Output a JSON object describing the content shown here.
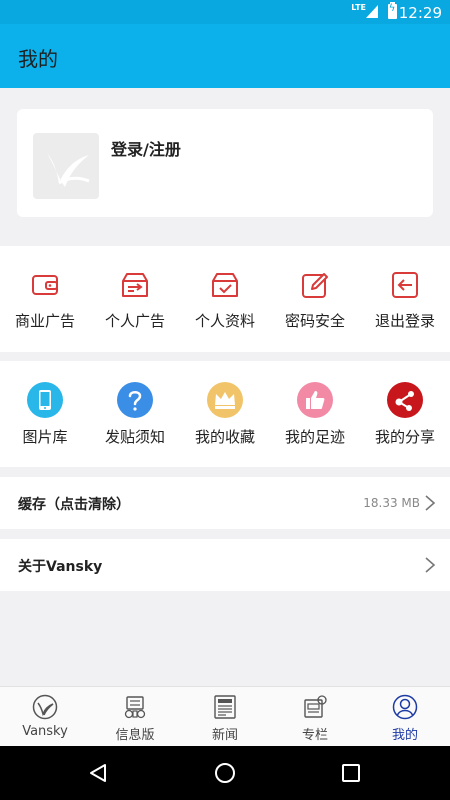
{
  "status_bar": {
    "network": "LTE",
    "time": "12:29"
  },
  "app_bar": {
    "title": "我的"
  },
  "profile": {
    "login_label": "登录/注册"
  },
  "actions": [
    {
      "label": "商业广告",
      "icon": "wallet-icon"
    },
    {
      "label": "个人广告",
      "icon": "box-arrow-icon"
    },
    {
      "label": "个人资料",
      "icon": "box-check-icon"
    },
    {
      "label": "密码安全",
      "icon": "edit-icon"
    },
    {
      "label": "退出登录",
      "icon": "logout-icon"
    }
  ],
  "features": [
    {
      "label": "图片库",
      "icon": "phone-icon",
      "color": "#29b6e8"
    },
    {
      "label": "发贴须知",
      "icon": "question-icon",
      "color": "#3a8ee6"
    },
    {
      "label": "我的收藏",
      "icon": "crown-icon",
      "color": "#f2c46a"
    },
    {
      "label": "我的足迹",
      "icon": "thumbs-up-icon",
      "color": "#f28aa6"
    },
    {
      "label": "我的分享",
      "icon": "share-icon",
      "color": "#c8161d"
    }
  ],
  "cache_row": {
    "label": "缓存（点击清除）",
    "value": "18.33 MB"
  },
  "about_row": {
    "label": "关于Vansky"
  },
  "tabs": [
    {
      "label": "Vansky",
      "icon": "vansky-logo-icon"
    },
    {
      "label": "信息版",
      "icon": "info-board-icon"
    },
    {
      "label": "新闻",
      "icon": "newspaper-icon"
    },
    {
      "label": "专栏",
      "icon": "column-icon"
    },
    {
      "label": "我的",
      "icon": "user-icon",
      "active": true
    }
  ],
  "colors": {
    "accent": "#0cb0ea",
    "action_red": "#d93a3a",
    "tab_active": "#1e3aa5"
  }
}
